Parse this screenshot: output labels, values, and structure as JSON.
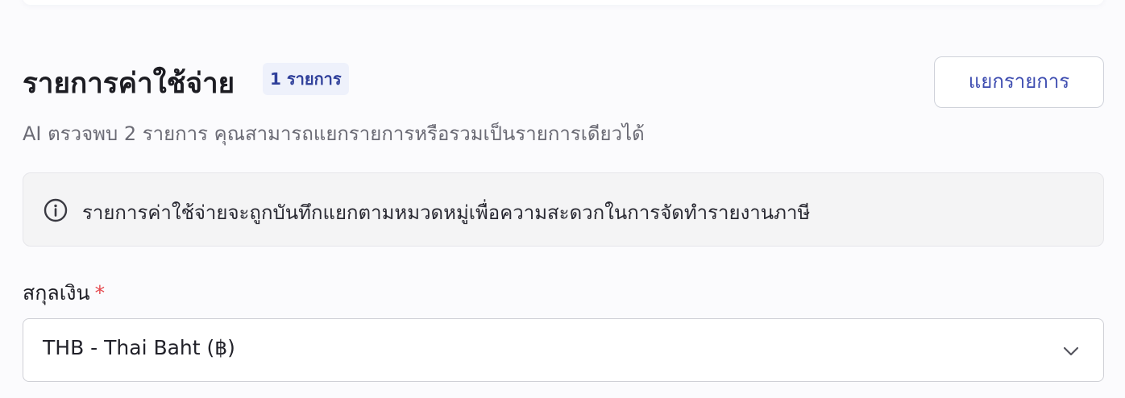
{
  "section": {
    "title": "รายการค่าใช้จ่าย",
    "count_badge": "1 รายการ",
    "split_button_label": "แยกรายการ",
    "subtitle": "AI ตรวจพบ 2 รายการ คุณสามารถแยกรายการหรือรวมเป็นรายการเดียวได้"
  },
  "info": {
    "icon": "info-circle-icon",
    "text": "รายการค่าใช้จ่ายจะถูกบันทึกแยกตามหมวดหมู่เพื่อความสะดวกในการจัดทำรายงานภาษี"
  },
  "currency": {
    "label": "สกุลเงิน",
    "required_mark": "*",
    "selected_value": "THB - Thai Baht (฿)",
    "icon": "chevron-down-icon"
  },
  "colors": {
    "accent": "#3d4cb0",
    "badge_bg": "#eef1fb",
    "required": "#e5484d",
    "info_bg": "#f4f4f5"
  }
}
